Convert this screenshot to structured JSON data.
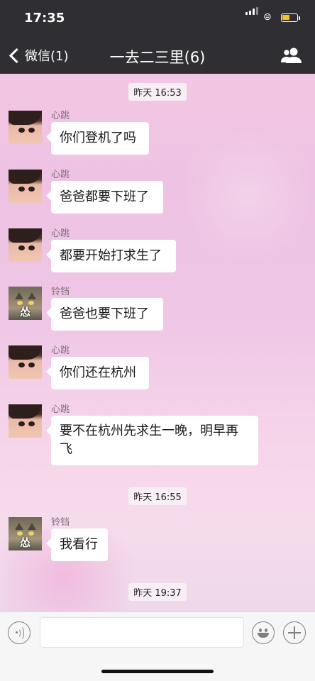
{
  "status_bar": {
    "time": "17:35",
    "battery_level": 0.55,
    "battery_color": "#f6c21c"
  },
  "nav": {
    "back_label": "微信(1)",
    "title": "一去二三里(6)"
  },
  "chat": {
    "timestamps": [
      "昨天 16:53",
      "昨天 16:55",
      "昨天 19:37"
    ],
    "messages": [
      {
        "sender": "心跳",
        "text": "你们登机了吗",
        "avatar": "girl-avatar"
      },
      {
        "sender": "心跳",
        "text": "爸爸都要下班了",
        "avatar": "girl-avatar"
      },
      {
        "sender": "心跳",
        "text": "都要开始打求生了",
        "avatar": "girl-avatar"
      },
      {
        "sender": "铃铛",
        "text": "爸爸也要下班了",
        "avatar": "cat-avatar",
        "avatar_caption": "怂"
      },
      {
        "sender": "心跳",
        "text": "你们还在杭州",
        "avatar": "girl-avatar"
      },
      {
        "sender": "心跳",
        "text_line1": "要不在杭州先求生一晚，明早再",
        "text_line2": "飞",
        "avatar": "girl-avatar"
      },
      {
        "sender": "铃铛",
        "text": "我看行",
        "avatar": "cat-avatar",
        "avatar_caption": "怂"
      }
    ]
  },
  "colors": {
    "nav_bg": "#2e2e33",
    "bubble_bg": "#ffffff",
    "chat_bg": "#efc6e6"
  }
}
